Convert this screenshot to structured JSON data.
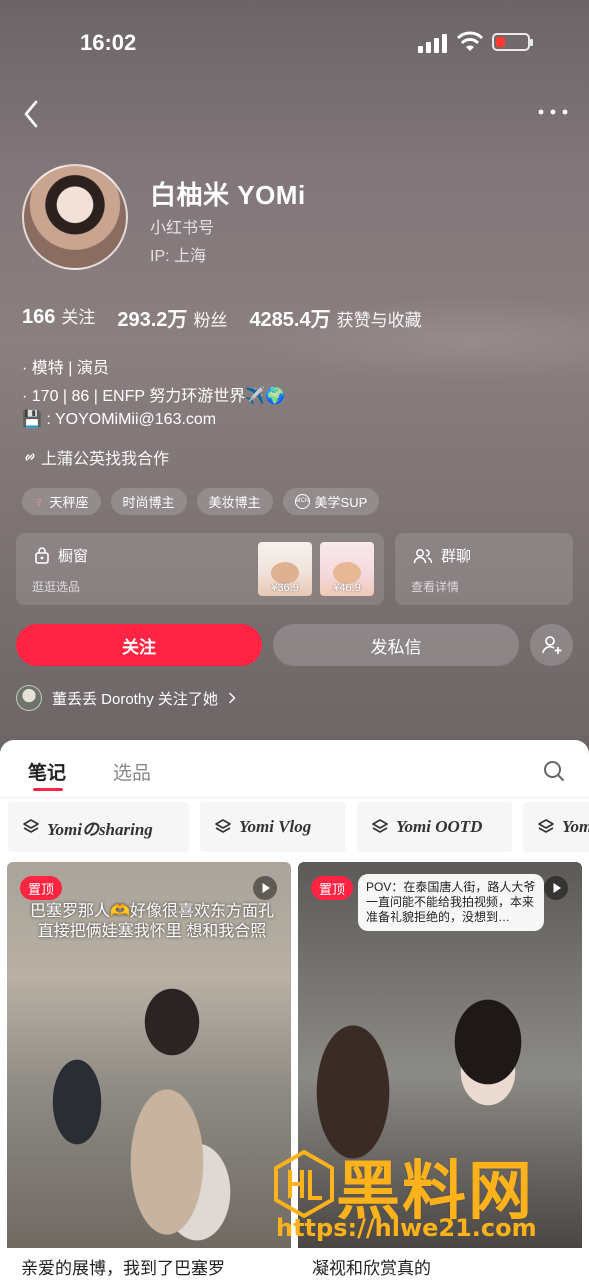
{
  "status_bar": {
    "time": "16:02"
  },
  "profile": {
    "name": "白柚米 YOMi",
    "id_label": "小红书号 ",
    "ip_label": "IP: 上海 "
  },
  "stats": [
    {
      "num": "166",
      "label": "关注"
    },
    {
      "num": "293.2万",
      "label": "粉丝"
    },
    {
      "num": "4285.4万",
      "label": "获赞与收藏"
    }
  ],
  "bio": {
    "line1": "· 模特 | 演员",
    "line2": "· 170 | 86 | ENFP  努力环游世界✈️🌍",
    "line3": "💾 : YOYOMiMii@163.com",
    "link": "上蒲公英找我合作"
  },
  "tags": [
    {
      "icon": "female-icon",
      "label": "天秤座"
    },
    {
      "icon": "",
      "label": "时尚博主"
    },
    {
      "icon": "",
      "label": "美妆博主"
    },
    {
      "icon": "mcn-icon",
      "label": "美学SUP"
    }
  ],
  "shop": {
    "title": "橱窗",
    "subtitle": "逛逛选品",
    "items": [
      {
        "price": "¥36.9"
      },
      {
        "price": "¥46.9"
      }
    ]
  },
  "group_chat": {
    "title": "群聊",
    "subtitle": "查看详情"
  },
  "actions": {
    "follow": "关注",
    "message": "发私信"
  },
  "mutual": {
    "text": "董丢丢 Dorothy 关注了她"
  },
  "tabs": {
    "notes": "笔记",
    "picks": "选品"
  },
  "chips": [
    "Yomiのsharing",
    "Yomi Vlog",
    "Yomi OOTD",
    "Yomi"
  ],
  "notes": [
    {
      "badge": "置顶",
      "caption": "巴塞罗那人🫶好像很喜欢东方面孔 直接把俩娃塞我怀里 想和我合照",
      "title": "亲爱的展博，我到了巴塞罗"
    },
    {
      "badge": "置顶",
      "caption": "POV：在泰国唐人街，路人大爷一直问能不能给我拍视频，本来准备礼貌拒绝的，没想到…",
      "title": "凝视和欣赏真的"
    }
  ],
  "watermark": {
    "logo": "HL",
    "text": "黑料网",
    "url": "https://hlwe21.com"
  },
  "colors": {
    "accent": "#ff2442",
    "watermark": "#ffb21a"
  }
}
